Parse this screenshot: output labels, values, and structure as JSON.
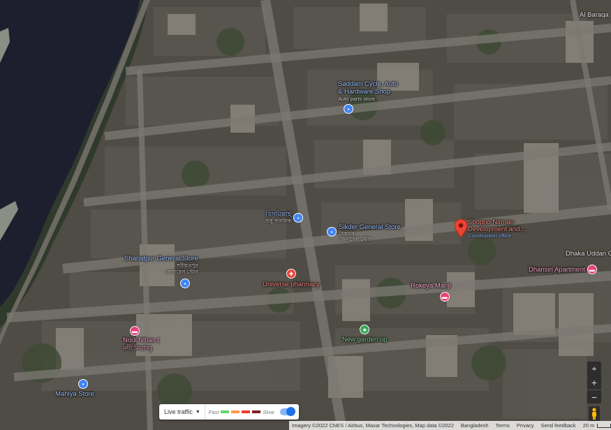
{
  "pois": [
    {
      "id": "saddam",
      "name_line1": "Saddam Cycle, Auto",
      "name_line2": "& Hardware Shop",
      "sub": "Auto parts store",
      "icon": "shopping-bag-icon",
      "color": "#4285f4"
    },
    {
      "id": "bishimillah",
      "name_line1": "বিসমিল্লাহ",
      "name_line2": "শুধু পাবলিক",
      "sub": "",
      "icon": "shopping-bag-icon",
      "color": "#4285f4"
    },
    {
      "id": "sikder",
      "name_line1": "Sikder General Store",
      "name_line2": "সিকদার",
      "sub": "জেনারেল স্টোর",
      "icon": "shopping-bag-icon",
      "color": "#4285f4"
    },
    {
      "id": "shariatpur",
      "name_line1": "Shariatpur General Store",
      "name_line2": "শরীয়তপুর",
      "sub": "জেনারেল স্টোর",
      "icon": "shopping-bag-icon",
      "color": "#4285f4"
    },
    {
      "id": "universe",
      "name_line1": "Universe pharmacy",
      "name_line2": "",
      "sub": "",
      "icon": "pharmacy-icon",
      "color": "#ea4335"
    },
    {
      "id": "rokeya",
      "name_line1": "Rokeya Manji",
      "name_line2": "",
      "sub": "",
      "icon": "lodging-icon",
      "color": "#e8427a"
    },
    {
      "id": "dhansiri",
      "name_line1": "Dhansiri Apartment",
      "name_line2": "",
      "sub": "",
      "icon": "lodging-icon",
      "color": "#e8427a"
    },
    {
      "id": "newgarden",
      "name_line1": "New garden up",
      "name_line2": "",
      "sub": "",
      "icon": "park-icon",
      "color": "#34a853"
    },
    {
      "id": "nodi",
      "name_line1": "Nodi Nibas (",
      "name_line2": "নদী নিবাস)",
      "sub": "",
      "icon": "lodging-icon",
      "color": "#e8427a"
    },
    {
      "id": "mahiya",
      "name_line1": "Mahiya Store",
      "name_line2": "",
      "sub": "",
      "icon": "shopping-bag-icon",
      "color": "#4285f4"
    },
    {
      "id": "shopno",
      "name_line1": "Shopno Nirman",
      "name_line2": "Development and...",
      "sub": "Construction office",
      "icon": "red-pin-icon",
      "color": "#ea4335"
    }
  ],
  "edge_labels": {
    "al_baraqa": "Al Baraqa",
    "dhaka_uddan": "Dhaka Uddan C"
  },
  "traffic": {
    "select_label": "Live traffic",
    "fast_label": "Fast",
    "slow_label": "Slow",
    "colors": [
      "#63d668",
      "#ff974d",
      "#f23c32",
      "#811f1f"
    ],
    "enabled": true
  },
  "footer": {
    "imagery": "Imagery ©2022 CNES / Airbus, Maxar Technologies, Map data ©2022",
    "country": "Bangladesh",
    "terms": "Terms",
    "privacy": "Privacy",
    "feedback": "Send feedback",
    "scale": "20 m"
  },
  "controls": {
    "zoom_in": "+",
    "zoom_out": "−"
  }
}
